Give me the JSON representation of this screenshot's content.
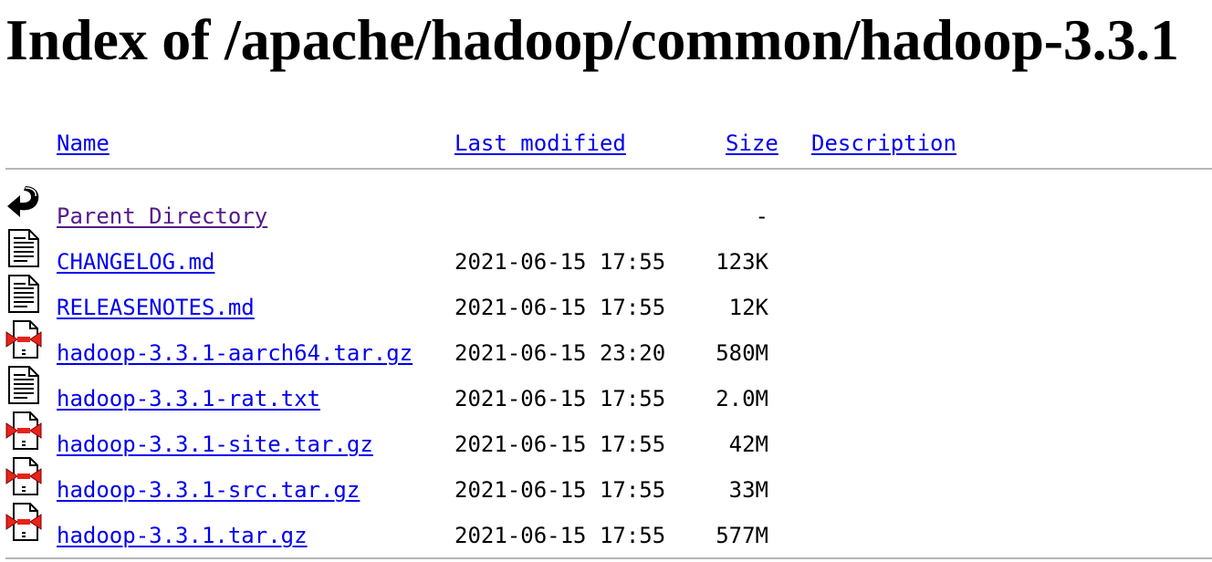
{
  "title": "Index of /apache/hadoop/common/hadoop-3.3.1",
  "columns": {
    "name": "Name",
    "last_modified": "Last modified",
    "size": "Size",
    "description": "Description"
  },
  "parent": {
    "label": "Parent Directory",
    "size": "-",
    "icon": "back-arrow-icon"
  },
  "files": [
    {
      "name": "CHANGELOG.md",
      "modified": "2021-06-15 17:55",
      "size": "123K",
      "icon": "text-file-icon"
    },
    {
      "name": "RELEASENOTES.md",
      "modified": "2021-06-15 17:55",
      "size": "12K",
      "icon": "text-file-icon"
    },
    {
      "name": "hadoop-3.3.1-aarch64.tar.gz",
      "modified": "2021-06-15 23:20",
      "size": "580M",
      "icon": "compressed-file-icon"
    },
    {
      "name": "hadoop-3.3.1-rat.txt",
      "modified": "2021-06-15 17:55",
      "size": "2.0M",
      "icon": "text-file-icon"
    },
    {
      "name": "hadoop-3.3.1-site.tar.gz",
      "modified": "2021-06-15 17:55",
      "size": "42M",
      "icon": "compressed-file-icon"
    },
    {
      "name": "hadoop-3.3.1-src.tar.gz",
      "modified": "2021-06-15 17:55",
      "size": "33M",
      "icon": "compressed-file-icon"
    },
    {
      "name": "hadoop-3.3.1.tar.gz",
      "modified": "2021-06-15 17:55",
      "size": "577M",
      "icon": "compressed-file-icon"
    }
  ],
  "colors": {
    "link": "#0000ee",
    "visited_link": "#551a8b",
    "rule": "#b5b5b5"
  }
}
